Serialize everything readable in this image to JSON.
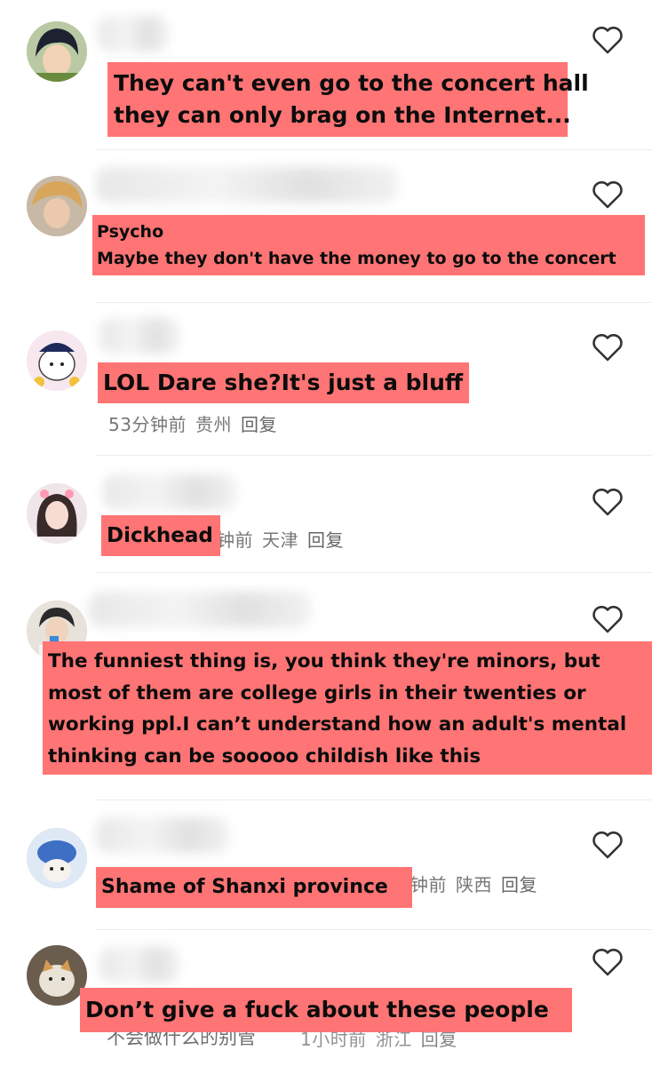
{
  "comments": [
    {
      "id": "c1",
      "caption_lines": [
        "They can't even go to the concert hall",
        "they can only brag on the Internet..."
      ]
    },
    {
      "id": "c2",
      "caption_lines": [
        "Psycho",
        "Maybe they don't have the money to go to the concert"
      ]
    },
    {
      "id": "c3",
      "caption_lines": [
        "LOL Dare she?It's just a bluff"
      ],
      "meta": {
        "time": "53分钟前",
        "place": "贵州",
        "reply": "回复"
      }
    },
    {
      "id": "c4",
      "caption_lines": [
        "Dickhead"
      ],
      "meta": {
        "time": "钟前",
        "place": "天津",
        "reply": "回复"
      }
    },
    {
      "id": "c5",
      "caption_lines": [
        "The funniest thing is, you think they're minors, but",
        "most of them are college girls in their twenties or",
        "working ppl.I can’t understand how an adult's mental",
        "thinking can be sooooo childish like this"
      ]
    },
    {
      "id": "c6",
      "caption_lines": [
        "Shame of Shanxi province"
      ],
      "meta": {
        "time": "钟前",
        "place": "陕西",
        "reply": "回复"
      }
    },
    {
      "id": "c7",
      "caption_lines": [
        "Don’t give a fuck about these people"
      ],
      "partial_body": "不会做什么的别管",
      "meta": {
        "time": "1小时前",
        "place": "浙江",
        "reply": "回复"
      }
    }
  ],
  "icons": {
    "like": "heart-outline-icon"
  },
  "colors": {
    "caption_background": "#ff7474",
    "meta_text": "#777777",
    "divider": "#ececec"
  }
}
